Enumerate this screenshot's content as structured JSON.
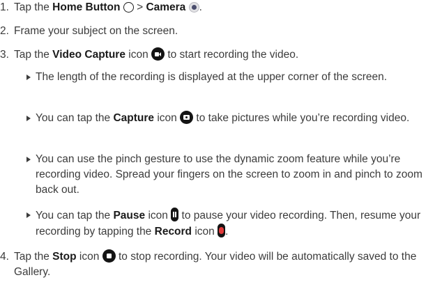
{
  "steps": [
    {
      "num": "1.",
      "t1": "Tap the ",
      "b1": "Home Button",
      "t2": " > ",
      "b2": "Camera",
      "t3": "."
    },
    {
      "num": "2.",
      "text": "Frame your subject on the screen."
    },
    {
      "num": "3.",
      "t1": "Tap the ",
      "b1": "Video Capture",
      "t2": " icon ",
      "t3": " to start recording the video."
    },
    {
      "num": "4.",
      "t1": "Tap the ",
      "b1": "Stop",
      "t2": " icon ",
      "t3": " to stop recording. Your video will be automatically saved to the Gallery."
    }
  ],
  "bullets": [
    {
      "text": "The length of the recording is displayed at the upper corner of the screen."
    },
    {
      "t1": "You can tap the ",
      "b1": "Capture",
      "t2": " icon ",
      "t3": " to take pictures while you’re recording video."
    },
    {
      "text": "You can use the pinch gesture to use the dynamic zoom feature while you’re recording video. Spread your fingers on the screen to zoom in and pinch to zoom back out."
    },
    {
      "t1": "You can tap the ",
      "b1": "Pause",
      "t2": " icon ",
      "t3": " to pause your video recording. Then, resume your recording by tapping the ",
      "b2": "Record",
      "t4": " icon ",
      "t5": "."
    }
  ],
  "icons": {
    "home": "home-button-icon",
    "camera": "camera-app-icon",
    "video_capture": "video-capture-icon",
    "capture": "capture-icon",
    "pause": "pause-icon",
    "record": "record-icon",
    "stop": "stop-icon",
    "record_color": "#e23939"
  }
}
